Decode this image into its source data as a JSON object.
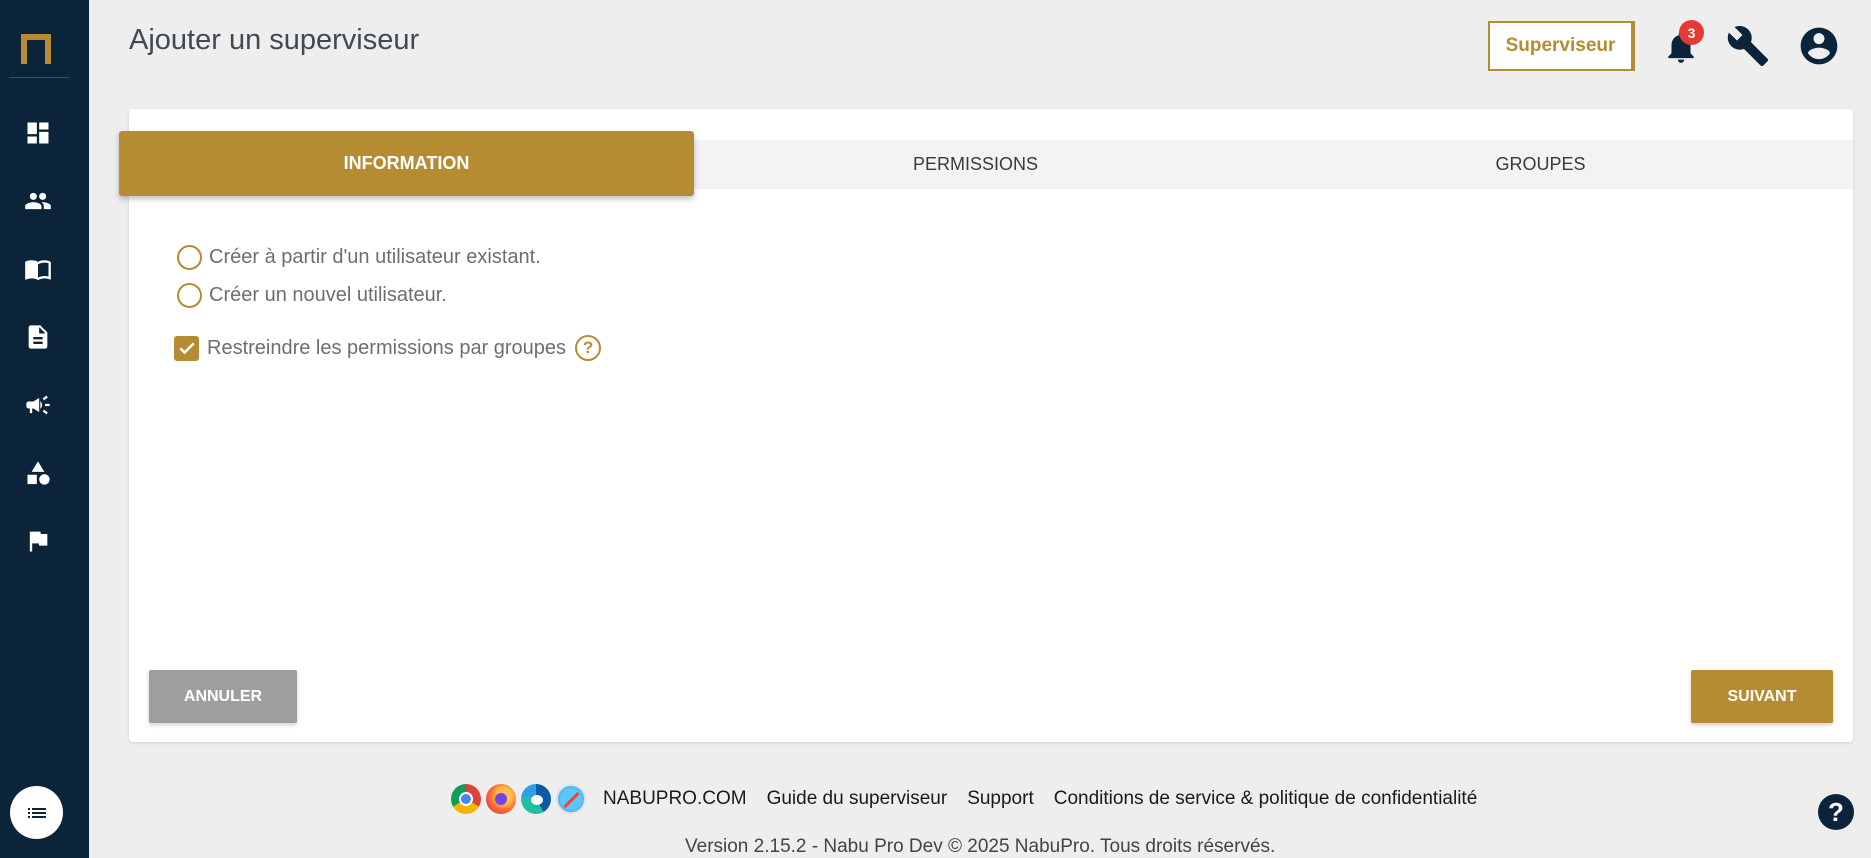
{
  "page": {
    "title": "Ajouter un superviseur"
  },
  "header": {
    "role_label": "Superviseur",
    "notification_count": "3",
    "help_symbol": "?"
  },
  "sidebar": {
    "items": [
      {
        "icon": "dashboard-icon"
      },
      {
        "icon": "users-icon"
      },
      {
        "icon": "book-icon"
      },
      {
        "icon": "document-icon"
      },
      {
        "icon": "campaign-icon"
      },
      {
        "icon": "shapes-icon"
      },
      {
        "icon": "flag-icon"
      }
    ]
  },
  "tabs": [
    {
      "label": "INFORMATION",
      "active": true
    },
    {
      "label": "PERMISSIONS",
      "active": false
    },
    {
      "label": "GROUPES",
      "active": false
    }
  ],
  "form": {
    "radio_existing": "Créer à partir d'un utilisateur existant.",
    "radio_new": "Créer un nouvel utilisateur.",
    "restrict_label": "Restreindre les permissions par groupes",
    "restrict_checked": true
  },
  "actions": {
    "cancel_label": "ANNULER",
    "next_label": "SUIVANT"
  },
  "footer": {
    "links": [
      "NABUPRO.COM",
      "Guide du superviseur",
      "Support",
      "Conditions de service & politique de confidentialité"
    ],
    "version": "Version 2.15.2 - Nabu Pro Dev © 2025 NabuPro. Tous droits réservés."
  },
  "colors": {
    "accent": "#b58c32",
    "sidebar": "#0b2439",
    "background": "#eeeeee"
  }
}
